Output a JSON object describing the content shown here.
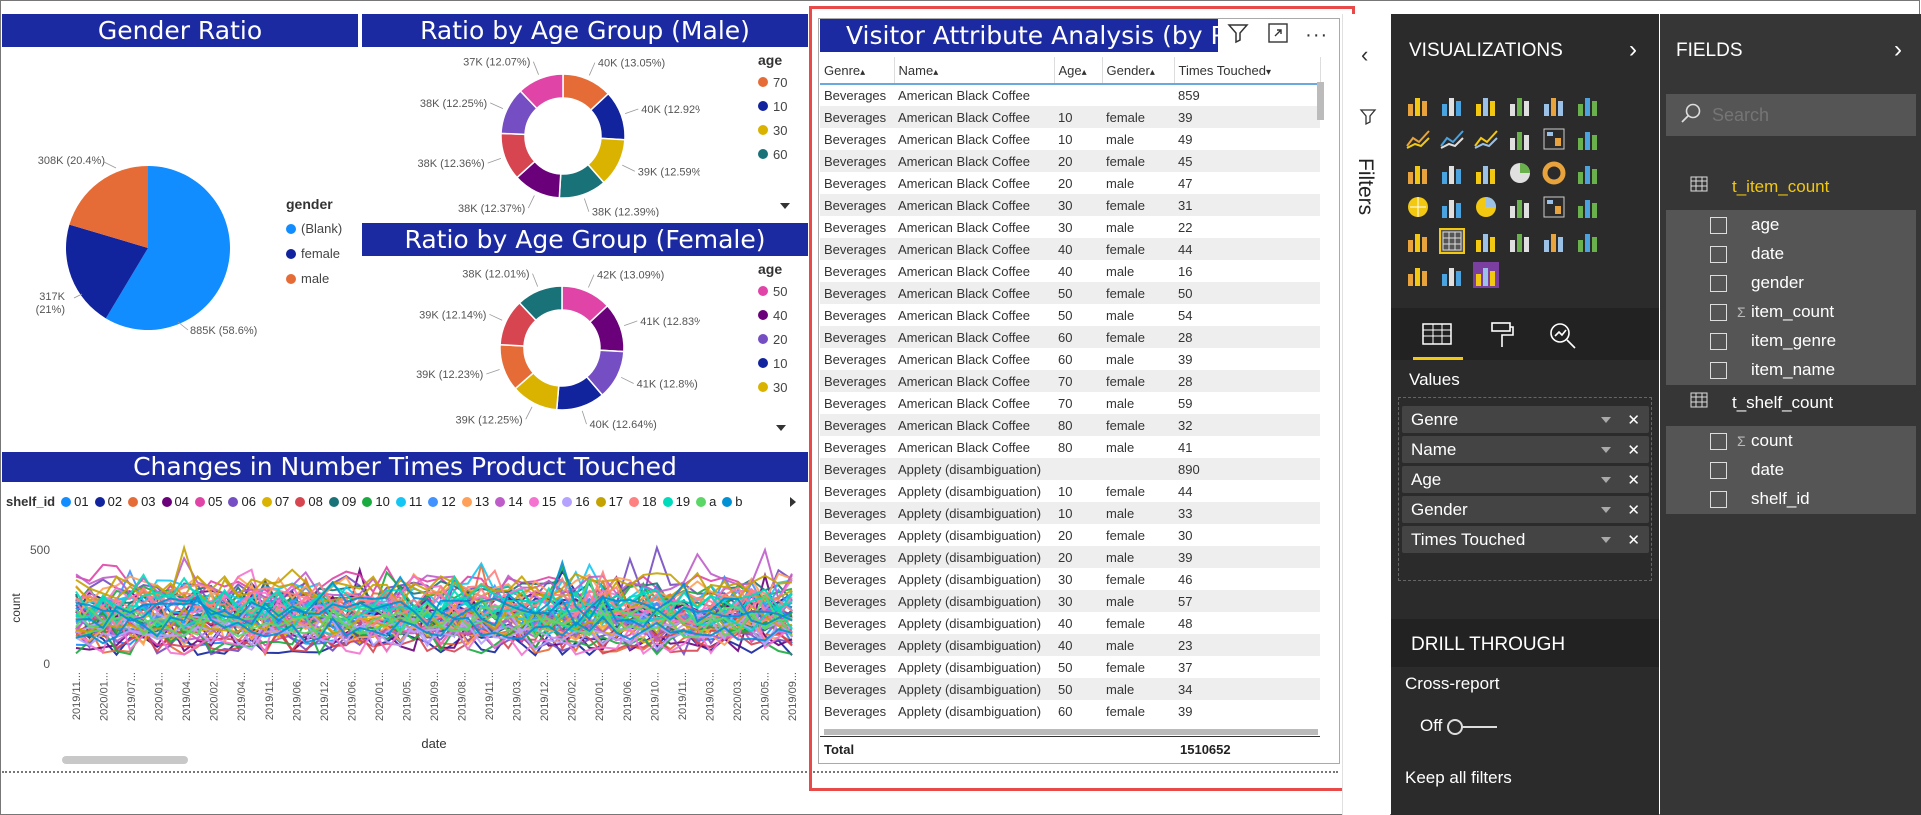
{
  "report": {
    "gender_ratio": {
      "title": "Gender Ratio",
      "legend_title": "gender",
      "legend": [
        {
          "label": "(Blank)",
          "color": "#118dff"
        },
        {
          "label": "female",
          "color": "#12239e"
        },
        {
          "label": "male",
          "color": "#e66c37"
        }
      ],
      "slices": [
        {
          "label": "885K (58.6%)",
          "value": 885,
          "percent": 58.6,
          "color": "#118dff"
        },
        {
          "label": "317K (21%)",
          "value": 317,
          "percent": 21,
          "color": "#12239e"
        },
        {
          "label": "308K (20.4%)",
          "value": 308,
          "percent": 20.4,
          "color": "#e66c37"
        }
      ]
    },
    "age_male": {
      "title": "Ratio by Age Group (Male)",
      "legend_title": "age",
      "legend": [
        {
          "label": "70",
          "color": "#e66c37"
        },
        {
          "label": "10",
          "color": "#12239e"
        },
        {
          "label": "30",
          "color": "#d9b300"
        },
        {
          "label": "60",
          "color": "#197278"
        }
      ],
      "slices": [
        {
          "label": "40K (13.05%)",
          "percent": 13.05,
          "color": "#e66c37"
        },
        {
          "label": "40K (12.92%)",
          "percent": 12.92,
          "color": "#12239e"
        },
        {
          "label": "39K (12.59%)",
          "percent": 12.59,
          "color": "#d9b300"
        },
        {
          "label": "38K (12.39%)",
          "percent": 12.39,
          "color": "#197278"
        },
        {
          "label": "38K (12.37%)",
          "percent": 12.37,
          "color": "#6b007b"
        },
        {
          "label": "38K (12.36%)",
          "percent": 12.36,
          "color": "#d64550"
        },
        {
          "label": "38K (12.25%)",
          "percent": 12.25,
          "color": "#744ec2"
        },
        {
          "label": "37K (12.07%)",
          "percent": 12.07,
          "color": "#e044a7"
        }
      ]
    },
    "age_female": {
      "title": "Ratio by Age Group (Female)",
      "legend_title": "age",
      "legend": [
        {
          "label": "50",
          "color": "#e044a7"
        },
        {
          "label": "40",
          "color": "#6b007b"
        },
        {
          "label": "20",
          "color": "#744ec2"
        },
        {
          "label": "10",
          "color": "#12239e"
        },
        {
          "label": "30",
          "color": "#d9b300"
        }
      ],
      "slices": [
        {
          "label": "42K (13.09%)",
          "percent": 13.09,
          "color": "#e044a7"
        },
        {
          "label": "41K (12.83%)",
          "percent": 12.83,
          "color": "#6b007b"
        },
        {
          "label": "41K (12.8%)",
          "percent": 12.8,
          "color": "#744ec2"
        },
        {
          "label": "40K (12.64%)",
          "percent": 12.64,
          "color": "#12239e"
        },
        {
          "label": "39K (12.25%)",
          "percent": 12.25,
          "color": "#d9b300"
        },
        {
          "label": "39K (12.23%)",
          "percent": 12.23,
          "color": "#e66c37"
        },
        {
          "label": "39K (12.14%)",
          "percent": 12.14,
          "color": "#d64550"
        },
        {
          "label": "38K (12.01%)",
          "percent": 12.01,
          "color": "#197278"
        }
      ]
    },
    "changes": {
      "title": "Changes in Number Times Product Touched",
      "legend_title": "shelf_id",
      "legend": [
        {
          "label": "01",
          "color": "#118dff"
        },
        {
          "label": "02",
          "color": "#12239e"
        },
        {
          "label": "03",
          "color": "#e66c37"
        },
        {
          "label": "04",
          "color": "#6b007b"
        },
        {
          "label": "05",
          "color": "#e044a7"
        },
        {
          "label": "06",
          "color": "#744ec2"
        },
        {
          "label": "07",
          "color": "#d9b300"
        },
        {
          "label": "08",
          "color": "#d64550"
        },
        {
          "label": "09",
          "color": "#197278"
        },
        {
          "label": "10",
          "color": "#1aab40"
        },
        {
          "label": "11",
          "color": "#15c6f4"
        },
        {
          "label": "12",
          "color": "#4092ff"
        },
        {
          "label": "13",
          "color": "#ffa058"
        },
        {
          "label": "14",
          "color": "#be5dc9"
        },
        {
          "label": "15",
          "color": "#f472d0"
        },
        {
          "label": "16",
          "color": "#b5a1ff"
        },
        {
          "label": "17",
          "color": "#c4a200"
        },
        {
          "label": "18",
          "color": "#ff8080"
        },
        {
          "label": "19",
          "color": "#00dbbc"
        },
        {
          "label": "a",
          "color": "#5bd667"
        },
        {
          "label": "b",
          "color": "#0091d5"
        }
      ],
      "ylabel": "count",
      "xlabel": "date",
      "yticks": [
        "500",
        "0"
      ],
      "xticks": [
        "2019/11...",
        "2020/01...",
        "2019/07...",
        "2020/01...",
        "2019/04...",
        "2020/02...",
        "2019/04...",
        "2019/11...",
        "2019/06...",
        "2019/12...",
        "2019/06...",
        "2020/01...",
        "2019/05...",
        "2019/09...",
        "2019/08...",
        "2019/11...",
        "2019/03...",
        "2019/12...",
        "2020/02...",
        "2020/01...",
        "2019/06...",
        "2019/10...",
        "2019/11...",
        "2019/03...",
        "2020/03...",
        "2019/05...",
        "2019/09..."
      ]
    },
    "table": {
      "title": "Visitor Attribute Analysis (by P",
      "columns": [
        "Genre",
        "Name",
        "Age",
        "Gender",
        "Times Touched"
      ],
      "rows": [
        [
          "Beverages",
          "American Black Coffee",
          "",
          "",
          "859"
        ],
        [
          "Beverages",
          "American Black Coffee",
          "10",
          "female",
          "39"
        ],
        [
          "Beverages",
          "American Black Coffee",
          "10",
          "male",
          "49"
        ],
        [
          "Beverages",
          "American Black Coffee",
          "20",
          "female",
          "45"
        ],
        [
          "Beverages",
          "American Black Coffee",
          "20",
          "male",
          "47"
        ],
        [
          "Beverages",
          "American Black Coffee",
          "30",
          "female",
          "31"
        ],
        [
          "Beverages",
          "American Black Coffee",
          "30",
          "male",
          "22"
        ],
        [
          "Beverages",
          "American Black Coffee",
          "40",
          "female",
          "44"
        ],
        [
          "Beverages",
          "American Black Coffee",
          "40",
          "male",
          "16"
        ],
        [
          "Beverages",
          "American Black Coffee",
          "50",
          "female",
          "50"
        ],
        [
          "Beverages",
          "American Black Coffee",
          "50",
          "male",
          "54"
        ],
        [
          "Beverages",
          "American Black Coffee",
          "60",
          "female",
          "28"
        ],
        [
          "Beverages",
          "American Black Coffee",
          "60",
          "male",
          "39"
        ],
        [
          "Beverages",
          "American Black Coffee",
          "70",
          "female",
          "28"
        ],
        [
          "Beverages",
          "American Black Coffee",
          "70",
          "male",
          "59"
        ],
        [
          "Beverages",
          "American Black Coffee",
          "80",
          "female",
          "32"
        ],
        [
          "Beverages",
          "American Black Coffee",
          "80",
          "male",
          "41"
        ],
        [
          "Beverages",
          "Applety (disambiguation)",
          "",
          "",
          "890"
        ],
        [
          "Beverages",
          "Applety (disambiguation)",
          "10",
          "female",
          "44"
        ],
        [
          "Beverages",
          "Applety (disambiguation)",
          "10",
          "male",
          "33"
        ],
        [
          "Beverages",
          "Applety (disambiguation)",
          "20",
          "female",
          "30"
        ],
        [
          "Beverages",
          "Applety (disambiguation)",
          "20",
          "male",
          "39"
        ],
        [
          "Beverages",
          "Applety (disambiguation)",
          "30",
          "female",
          "46"
        ],
        [
          "Beverages",
          "Applety (disambiguation)",
          "30",
          "male",
          "57"
        ],
        [
          "Beverages",
          "Applety (disambiguation)",
          "40",
          "female",
          "48"
        ],
        [
          "Beverages",
          "Applety (disambiguation)",
          "40",
          "male",
          "23"
        ],
        [
          "Beverages",
          "Applety (disambiguation)",
          "50",
          "female",
          "37"
        ],
        [
          "Beverages",
          "Applety (disambiguation)",
          "50",
          "male",
          "34"
        ],
        [
          "Beverages",
          "Applety (disambiguation)",
          "60",
          "female",
          "39"
        ]
      ],
      "total_label": "Total",
      "total_value": "1510652"
    }
  },
  "filters_label": "Filters",
  "visualizations": {
    "title": "VISUALIZATIONS",
    "values_label": "Values",
    "wells": [
      "Genre",
      "Name",
      "Age",
      "Gender",
      "Times Touched"
    ],
    "drill_through_title": "DRILL THROUGH",
    "cross_report_label": "Cross-report",
    "cross_report_state": "Off",
    "keep_all_filters_label": "Keep all filters"
  },
  "fields": {
    "title": "FIELDS",
    "search_placeholder": "Search",
    "tables": [
      {
        "name": "t_item_count",
        "highlighted": true,
        "fields": [
          {
            "name": "age",
            "sigma": false
          },
          {
            "name": "date",
            "sigma": false
          },
          {
            "name": "gender",
            "sigma": false
          },
          {
            "name": "item_count",
            "sigma": true
          },
          {
            "name": "item_genre",
            "sigma": false
          },
          {
            "name": "item_name",
            "sigma": false
          }
        ]
      },
      {
        "name": "t_shelf_count",
        "highlighted": false,
        "fields": [
          {
            "name": "count",
            "sigma": true
          },
          {
            "name": "date",
            "sigma": false
          },
          {
            "name": "shelf_id",
            "sigma": false
          }
        ]
      }
    ]
  },
  "chart_data": [
    {
      "type": "pie",
      "title": "Gender Ratio",
      "legend_title": "gender",
      "categories": [
        "(Blank)",
        "female",
        "male"
      ],
      "values": [
        885,
        317,
        308
      ],
      "unit": "K",
      "percent": [
        58.6,
        21,
        20.4
      ]
    },
    {
      "type": "pie",
      "title": "Ratio by Age Group (Male)",
      "legend_title": "age",
      "values": [
        40,
        40,
        39,
        38,
        38,
        38,
        38,
        37
      ],
      "unit": "K",
      "percent": [
        13.05,
        12.92,
        12.59,
        12.39,
        12.37,
        12.36,
        12.25,
        12.07
      ]
    },
    {
      "type": "pie",
      "title": "Ratio by Age Group (Female)",
      "legend_title": "age",
      "values": [
        42,
        41,
        41,
        40,
        39,
        39,
        39,
        38
      ],
      "unit": "K",
      "percent": [
        13.09,
        12.83,
        12.8,
        12.64,
        12.25,
        12.23,
        12.14,
        12.01
      ]
    },
    {
      "type": "line",
      "title": "Changes in Number Times Product Touched",
      "xlabel": "date",
      "ylabel": "count",
      "ylim": [
        0,
        500
      ],
      "legend_title": "shelf_id",
      "legend_placement": "top"
    }
  ]
}
